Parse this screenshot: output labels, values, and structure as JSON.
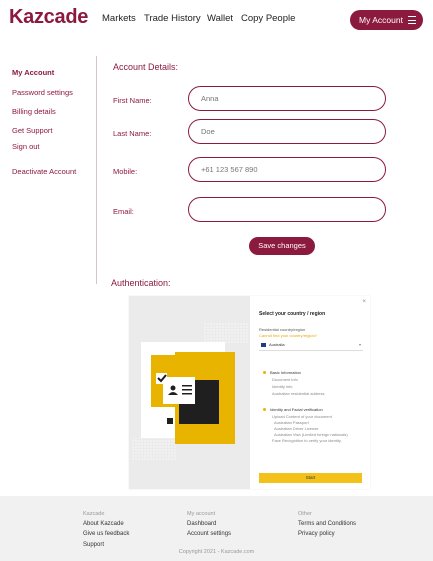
{
  "brand": {
    "logo": "Kazcade",
    "accent": "#8c1a3e"
  },
  "nav": {
    "items": [
      "Markets",
      "Trade History",
      "Wallet",
      "Copy People"
    ],
    "account_button": "My Account"
  },
  "sidebar": {
    "items": [
      "My Account",
      "Password settings",
      "Billing details",
      "Get Support",
      "Sign out",
      "Deactivate Account"
    ]
  },
  "details": {
    "title": "Account Details:",
    "first_name": {
      "label": "First Name:",
      "placeholder": "Anna"
    },
    "last_name": {
      "label": "Last Name:",
      "placeholder": "Doe"
    },
    "mobile": {
      "label": "Mobile:",
      "placeholder": "+61 123 567 890"
    },
    "email": {
      "label": "Email:",
      "placeholder": ""
    },
    "save_label": "Save changes"
  },
  "auth": {
    "title": "Authentication:",
    "widget": {
      "close": "×",
      "heading": "Select your country / region",
      "residential_label": "Residential country/region",
      "change_link": "Cannot find your country/region?",
      "country": "Australia",
      "basic_title": "Basic Information",
      "basic_items": [
        "Document info",
        "Identity info",
        "Australian residential address"
      ],
      "identity_title": "Identity and Facial verification",
      "identity_items": [
        "Upload Content of your document",
        "Australian Passport",
        "Australian Driver License",
        "Australian Visa (Limited foreign nationals)",
        "Face Recognition to verify your identity"
      ],
      "start_label": "Start"
    }
  },
  "footer": {
    "col1": {
      "heading": "Kazcade",
      "links": [
        "About Kazcade",
        "Give us feedback",
        "Support"
      ]
    },
    "col2": {
      "heading": "My account",
      "links": [
        "Dashboard",
        "Account settings"
      ]
    },
    "col3": {
      "heading": "Other",
      "links": [
        "Terms and Conditions",
        "Privacy policy"
      ]
    },
    "copyright": "Copyright 2021 - Kazcade.com"
  }
}
